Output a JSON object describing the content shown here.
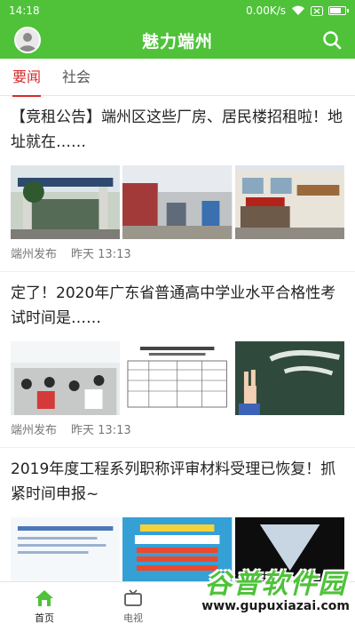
{
  "status_bar": {
    "time": "14:18",
    "speed": "0.00K/s"
  },
  "app_bar": {
    "title": "魅力端州"
  },
  "tabs": [
    {
      "label": "要闻"
    },
    {
      "label": "社会"
    }
  ],
  "articles": [
    {
      "headline": "【竞租公告】端州区这些厂房、居民楼招租啦！地址就在……",
      "source": "端州发布",
      "time": "昨天 13:13"
    },
    {
      "headline": "定了！2020年广东省普通高中学业水平合格性考试时间是……",
      "source": "端州发布",
      "time": "昨天 13:13"
    },
    {
      "headline": "2019年度工程系列职称评审材料受理已恢复！抓紧时间申报~"
    }
  ],
  "bottom_nav": [
    {
      "label": "首页"
    },
    {
      "label": "电视"
    }
  ],
  "watermark": {
    "name": "谷普软件园",
    "url": "www.gupuxiazai.com"
  },
  "colors": {
    "brand": "#4fc23a",
    "tab_active": "#d92a2a"
  }
}
